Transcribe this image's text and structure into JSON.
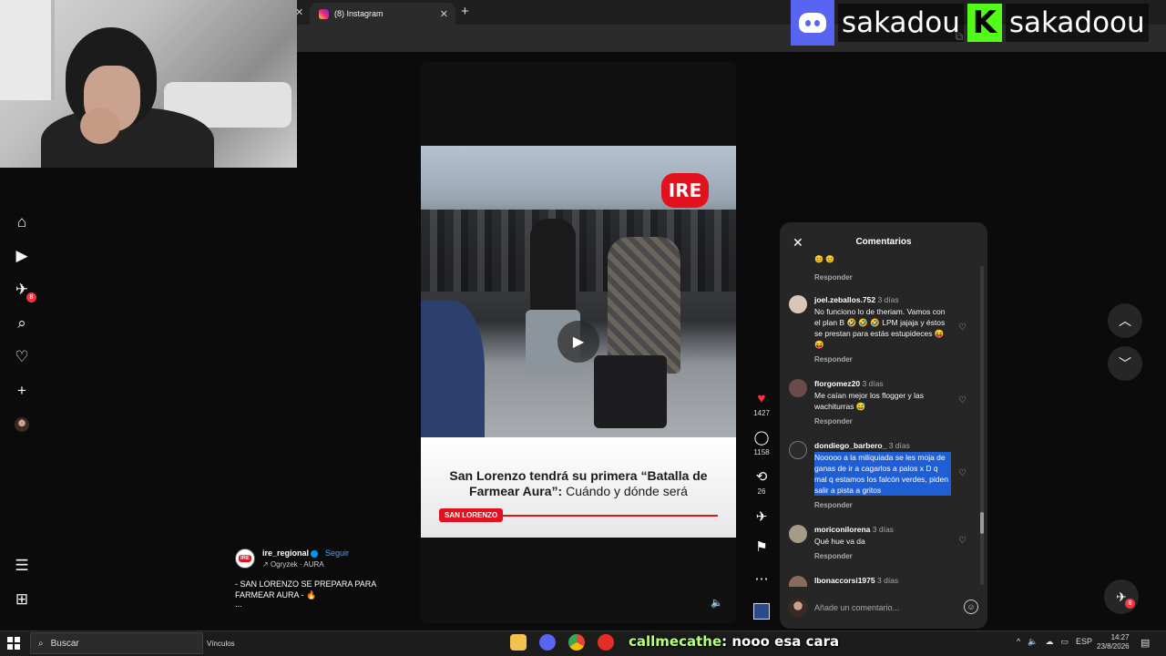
{
  "browser": {
    "tab_title": "(8) Instagram",
    "tab_close": "✕",
    "new_tab": "+"
  },
  "overlay": {
    "discord_name": "sakadou",
    "kick_letter": "K",
    "kick_name": "sakadoou"
  },
  "nav": {
    "messages_badge": "8"
  },
  "reel": {
    "brand_logo": "IRE",
    "headline_bold": "San Lorenzo tendrá su primera “Batalla de Farmear Aura”:",
    "headline_light": " Cuándo y dónde será",
    "tag": "SAN LORENZO",
    "account": "ire_regional",
    "follow_label": "Seguir",
    "audio": "Ogryzek · AURA",
    "caption_line1": "- SAN LORENZO SE PREPARA PARA",
    "caption_line2": "FARMEAR AURA - 🔥",
    "caption_more": "...",
    "likes": "1427",
    "comments_count": "1158",
    "reposts": "26"
  },
  "comments_panel": {
    "title": "Comentarios",
    "close_icon": "✕",
    "top_emojis": "😊 😊",
    "reply_label": "Responder",
    "input_placeholder": "Añade un comentario...",
    "items": [
      {
        "user": "joel.zeballos.752",
        "when": "3 días",
        "text": "No funciono lo de theriam. Vamos con el plan B 🤣 🤣 🤣 LPM jajaja y éstos se prestan para estás estupideces 😝 😝",
        "avatar_color": "#d9c7b6",
        "selected": false
      },
      {
        "user": "florgomez20",
        "when": "3 días",
        "text": "Me caían mejor los flogger y las wachiturras 😅",
        "avatar_color": "#6a4a4a",
        "selected": false
      },
      {
        "user": "dondiego_barbero_",
        "when": "3 días",
        "text": "Nooooo a la miliquiada se les moja de ganas de ir a cagarlos a palos x D q mal q estamos los falcón verdes, piden salir a pista a gritos",
        "avatar_color": "#2b2b2b",
        "selected": true
      },
      {
        "user": "moriconilorena",
        "when": "3 días",
        "text": "Qué hue va da",
        "avatar_color": "#a89a88",
        "selected": false
      },
      {
        "user": "lbonaccorsi1975",
        "when": "3 días",
        "text": "",
        "avatar_color": "#8a6a5a",
        "selected": false
      }
    ]
  },
  "taskbar": {
    "search_label": "Buscar",
    "links_label": "Vínculos",
    "chat_nick": "callmecathe",
    "chat_message": ": nooo esa cara",
    "lang": "ESP",
    "time": "14:27",
    "date": "23/8/2026"
  }
}
